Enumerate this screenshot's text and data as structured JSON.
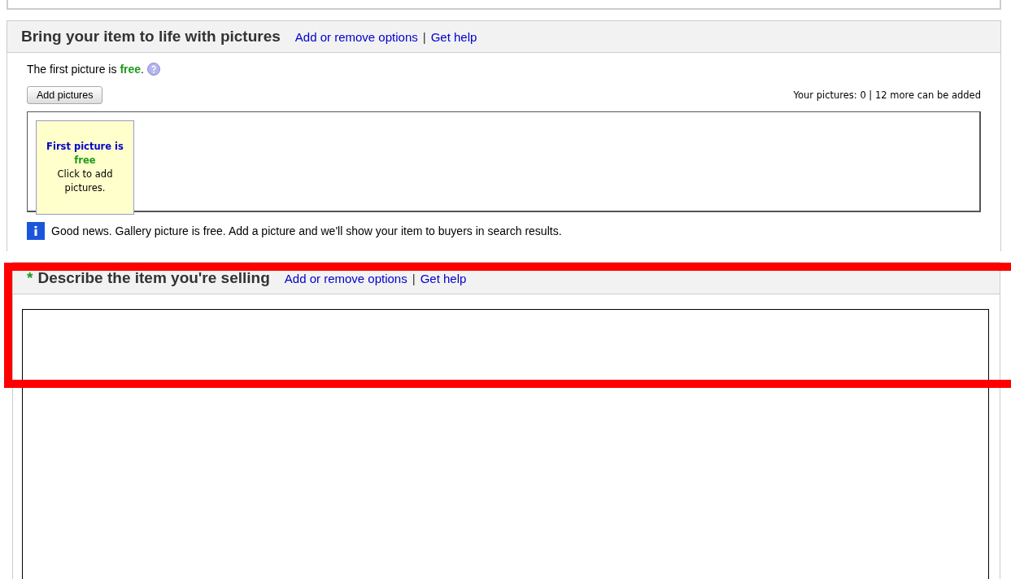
{
  "pictures_section": {
    "title": "Bring your item to life with pictures",
    "links": [
      "Add or remove options",
      "Get help"
    ],
    "separator": "|",
    "intro": "The first picture is **free**.",
    "add_button": "Add pictures",
    "counter": "Your pictures: 0 | 12 more can be added",
    "placeholder_tile": {
      "title": "First picture is",
      "free": "free",
      "hint": "Click to add pictures."
    },
    "notice": "Good news. Gallery picture is free. Add a picture and we'll show your item to buyers in search results."
  },
  "description_section": {
    "required": true,
    "required_mark": "*",
    "title": "Describe the item you're selling",
    "links": [
      "Add or remove options",
      "Get help"
    ],
    "separator": "|"
  }
}
